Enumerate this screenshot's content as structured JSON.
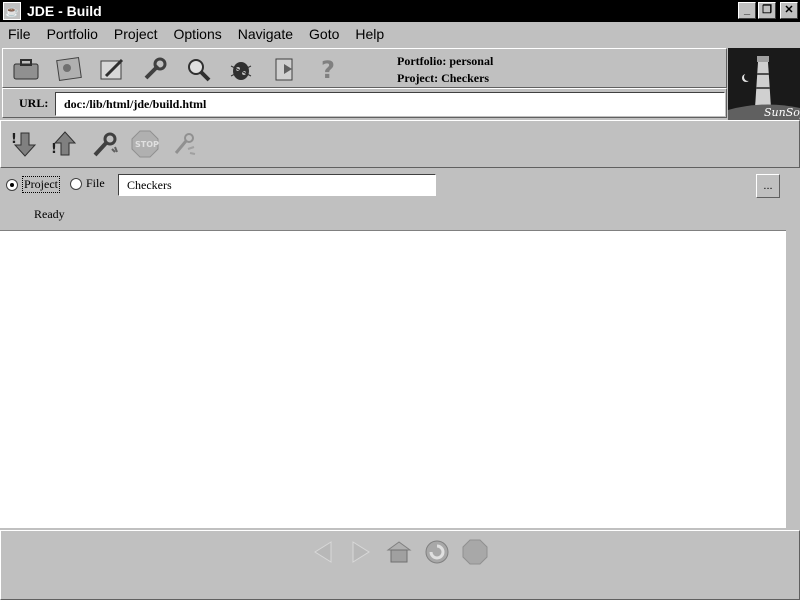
{
  "window": {
    "title": "JDE - Build"
  },
  "menu": [
    "File",
    "Portfolio",
    "Project",
    "Options",
    "Navigate",
    "Goto",
    "Help"
  ],
  "header": {
    "portfolio_label": "Portfolio:",
    "portfolio_value": "personal",
    "project_label": "Project:",
    "project_value": "Checkers"
  },
  "url": {
    "label": "URL:",
    "value": "doc:/lib/html/jde/build.html"
  },
  "build": {
    "radio_project_label": "Project",
    "radio_file_label": "File",
    "selected": "Project",
    "target_value": "Checkers",
    "browse_label": "...",
    "status": "Ready"
  },
  "logo": {
    "brand": "SunSoft"
  },
  "icons": {
    "toolbar1": [
      "briefcase-icon",
      "portfolio-icon",
      "edit-icon",
      "build-wrench-icon",
      "browse-magnifier-icon",
      "debug-bug-icon",
      "navigate-door-icon",
      "help-question-icon"
    ],
    "toolbar2": [
      "build-down-icon",
      "build-up-icon",
      "make-icon",
      "stop-icon",
      "clean-icon"
    ],
    "nav": [
      "back-icon",
      "forward-icon",
      "home-icon",
      "reload-icon",
      "stop-icon"
    ]
  }
}
